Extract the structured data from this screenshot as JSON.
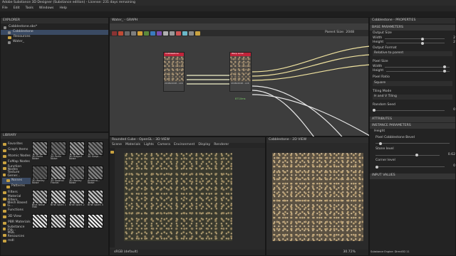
{
  "app": {
    "title": "Adobe Substance 3D Designer (Substance edition) - License: 231 days remaining"
  },
  "menu": [
    "File",
    "Edit",
    "Tools",
    "Windows",
    "Help"
  ],
  "explorer": {
    "title": "EXPLORER",
    "items": [
      {
        "label": "Cobblestone.sbs*"
      },
      {
        "label": "Cobblestone"
      },
      {
        "label": "Resources"
      },
      {
        "label": "Water_"
      }
    ]
  },
  "graph": {
    "tab": "Water_ - GRAPH",
    "parent_size_label": "Parent Size:",
    "parent_size": "2048",
    "nodes": [
      {
        "title": "Cobblestone",
        "subtitle": "2048x2048 - L16",
        "param": ""
      },
      {
        "title": "Warp Local",
        "subtitle": "2048x2048 - L16",
        "param": "8710ms"
      }
    ]
  },
  "library": {
    "title": "LIBRARY",
    "categories": [
      "Favorites",
      "Graph Items",
      "Atomic Nodes",
      "FxMap Nodes",
      "Function Nodes",
      "Texture Gener...",
      "Noises",
      "Patterns",
      "Filters",
      "Material Filters",
      "Mesh Based G...",
      "Functions",
      "3D View",
      "PBR Materials",
      "Substance ma...",
      "MDL Resources",
      "mdl"
    ],
    "selected": "Noises",
    "thumbs": [
      {
        "label": "3D Perlin Noise"
      },
      {
        "label": "3D Perlin Noise"
      },
      {
        "label": "3D Ridged Noise"
      },
      {
        "label": "3D Simpl..."
      },
      {
        "label": "3D Worley Noise"
      },
      {
        "label": "3D Voronoi Fractal"
      },
      {
        "label": "3D Worley Noise"
      },
      {
        "label": "Anisotro... Noise"
      },
      {
        "label": "Blue Noise Fast"
      },
      {
        "label": "BnW Spots 1"
      },
      {
        "label": "BnW Spots 2"
      },
      {
        "label": "BnW Spots 3"
      },
      {
        "label": ""
      },
      {
        "label": ""
      },
      {
        "label": ""
      },
      {
        "label": ""
      }
    ]
  },
  "view3d": {
    "tab": "Rounded Cube - OpenGL - 3D VIEW",
    "menu": [
      "Scene",
      "Materials",
      "Lights",
      "Camera",
      "Environment",
      "Display",
      "Renderer"
    ],
    "status": "sRGB (default)"
  },
  "view2d": {
    "tab": "Cobblestone - 2D VIEW",
    "zoom": "30.72%",
    "status_label": "Substance Engine: Direct3D 11"
  },
  "properties": {
    "title": "Cobblestone - PROPERTIES",
    "sections": {
      "base": "BASE PARAMETERS",
      "attributes": "ATTRIBUTES",
      "instance": "INSTANCE PARAMETERS",
      "inputs": "INPUT VALUES"
    },
    "output_size_label": "Output Size",
    "width_label": "Width",
    "height_label": "Height",
    "width_value": "2",
    "height_value": "2",
    "relative": "Relative to parent",
    "output_format_label": "Output Format",
    "output_format_value": "Relative to parent",
    "pixel_size_label": "Pixel Size",
    "pixel_ratio_label": "Pixel Ratio",
    "pixel_ratio_value": "Square",
    "tiling_mode_label": "Tiling Mode",
    "tiling_mode_value": "H and V Tiling",
    "random_seed_label": "Random Seed",
    "random_seed_value": "0",
    "height_group": "Height",
    "pixel_height_label": "Pixel Cobblestone Bevel",
    "stone_level_label": "Stone level",
    "stone_level_value": "0.62",
    "corner_level_label": "Corner level",
    "corner_level_value": "0"
  }
}
